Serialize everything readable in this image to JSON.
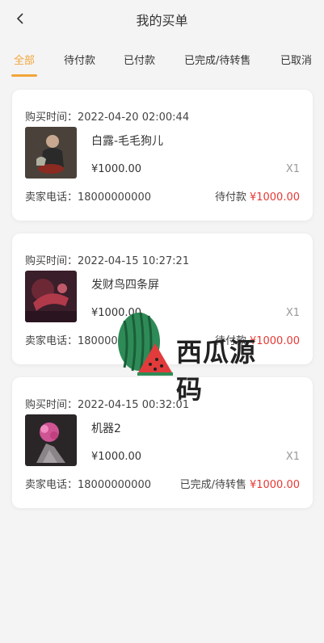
{
  "header": {
    "title": "我的买单"
  },
  "tabs": [
    {
      "label": "全部",
      "active": true
    },
    {
      "label": "待付款"
    },
    {
      "label": "已付款"
    },
    {
      "label": "已完成/待转售"
    },
    {
      "label": "已取消"
    }
  ],
  "labels": {
    "buy_time_prefix": "购买时间：",
    "seller_phone_prefix": "卖家电话："
  },
  "orders": [
    {
      "time": "2022-04-20 02:00:44",
      "name": "白露-毛毛狗儿",
      "price": "¥1000.00",
      "qty": "X1",
      "phone": "18000000000",
      "status": "待付款",
      "amount": "¥1000.00"
    },
    {
      "time": "2022-04-15 10:27:21",
      "name": "发财鸟四条屏",
      "price": "¥1000.00",
      "qty": "X1",
      "phone": "18000000000",
      "status": "待付款",
      "amount": "¥1000.00"
    },
    {
      "time": "2022-04-15 00:32:01",
      "name": "机器2",
      "price": "¥1000.00",
      "qty": "X1",
      "phone": "18000000000",
      "status": "已完成/待转售",
      "amount": "¥1000.00"
    }
  ],
  "watermark": {
    "text": "西瓜源码"
  },
  "colors": {
    "accent": "#f2a53a",
    "price_red": "#e53935",
    "background": "#f4f4f4"
  }
}
